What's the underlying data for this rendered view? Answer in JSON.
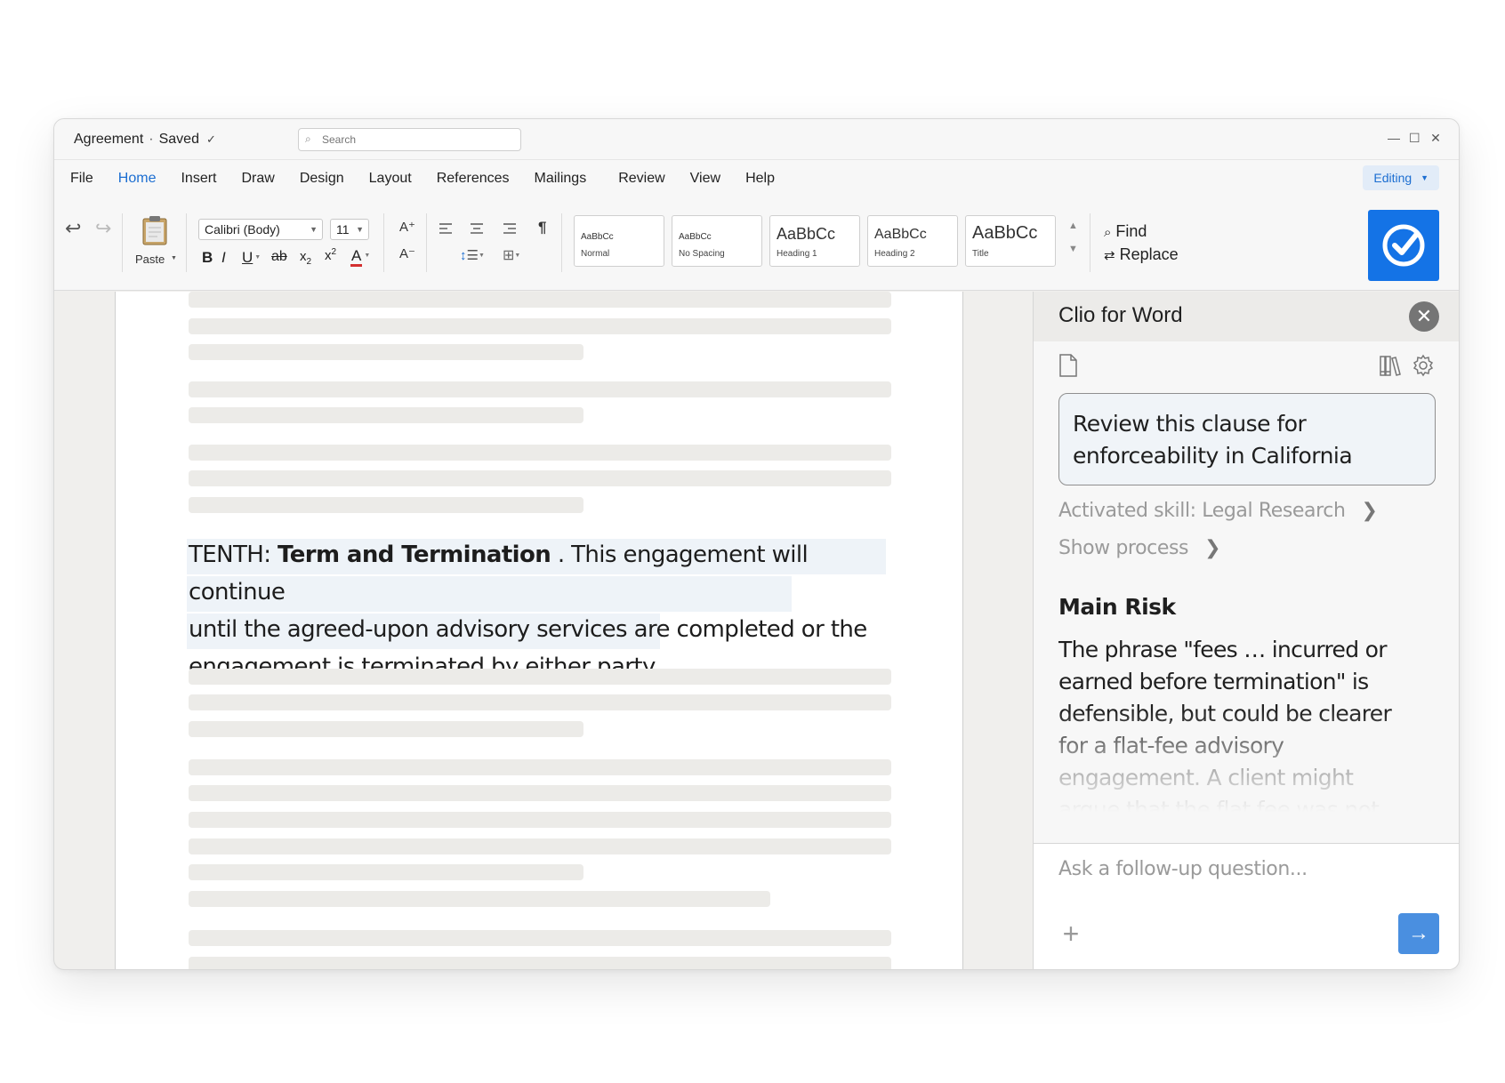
{
  "titlebar": {
    "doc_name": "Agreement",
    "separator": "·",
    "status": "Saved",
    "status_check": "✓",
    "search_placeholder": "Search"
  },
  "menu": {
    "items": [
      {
        "label": "File",
        "active": false
      },
      {
        "label": "Home",
        "active": true
      },
      {
        "label": "Insert",
        "active": false
      },
      {
        "label": "Draw",
        "active": false
      },
      {
        "label": "Design",
        "active": false
      },
      {
        "label": "Layout",
        "active": false
      },
      {
        "label": "References",
        "active": false
      },
      {
        "label": "Mailings",
        "active": false
      },
      {
        "label": "Review",
        "active": false
      },
      {
        "label": "View",
        "active": false
      },
      {
        "label": "Help",
        "active": false
      }
    ],
    "editing_label": "Editing"
  },
  "ribbon": {
    "paste_label": "Paste",
    "font_name": "Calibri (Body)",
    "font_size": "11",
    "format_buttons": {
      "bold": "B",
      "italic": "I",
      "underline": "U",
      "strike": "ab",
      "font_grow": "A⁺",
      "font_shrink": "A⁻",
      "font_color": "A",
      "pilcrow": "¶"
    },
    "styles": [
      {
        "sample": "AaBbCc",
        "name": "Normal",
        "large": false
      },
      {
        "sample": "AaBbCc",
        "name": "No Spacing",
        "large": false
      },
      {
        "sample": "AaBbCc",
        "name": "Heading 1",
        "large": true
      },
      {
        "sample": "AaBbCc",
        "name": "Heading 2",
        "large": true
      },
      {
        "sample": "AaBbCc",
        "name": "Title",
        "large": true
      }
    ],
    "find_label": "Find",
    "replace_label": "Replace"
  },
  "document": {
    "clause_prefix": "TENTH: ",
    "clause_heading": "Term and Termination",
    "clause_line1_rest": " . This engagement will continue",
    "clause_line2": "until the agreed-upon advisory services are completed or the",
    "clause_line3": "engagement is terminated by either party."
  },
  "panel": {
    "title": "Clio for Word",
    "prompt": "Review this clause for enforceability in California",
    "activated_skill": "Activated skill: Legal Research",
    "show_process": "Show process",
    "main_risk_heading": "Main Risk",
    "main_risk_text": "The phrase \"fees … incurred or earned before termination\" is defensible, but could be clearer for a flat-fee advisory engagement. A client might argue that the flat fee was not",
    "followup_placeholder": "Ask a follow-up question..."
  },
  "colors": {
    "accent": "#1c6ed1",
    "clio_blue": "#1473e6",
    "send_blue": "#4a8fe0",
    "placeholder_gray": "#ecebe8",
    "font_color_red": "#d32f2f"
  }
}
